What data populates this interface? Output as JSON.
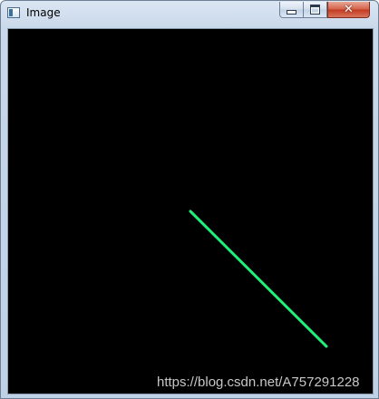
{
  "window": {
    "title": "Image",
    "minimize_icon": "minimize-icon",
    "maximize_icon": "maximize-icon",
    "close_icon": "close-icon",
    "close_glyph": "✕"
  },
  "canvas": {
    "background": "#000000",
    "line_color": "#1ff07a"
  },
  "watermark": {
    "text": "https://blog.csdn.net/A757291228"
  }
}
